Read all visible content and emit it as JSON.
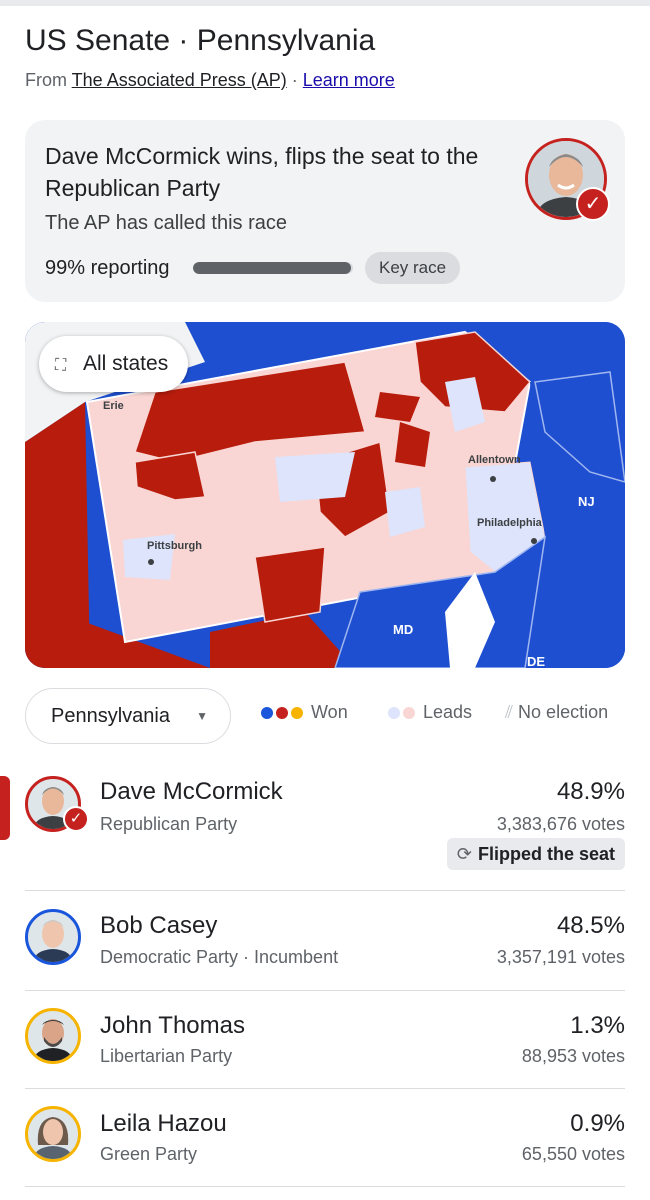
{
  "header": {
    "title": "US Senate · Pennsylvania",
    "source_prefix": "From ",
    "source_name": "The Associated Press (AP)",
    "separator": " · ",
    "learn_more": "Learn more"
  },
  "summary": {
    "headline": "Dave McCormick wins, flips the seat to the Republican Party",
    "called_text": "The AP has called this race",
    "reporting_text": "99% reporting",
    "reporting_fraction": 0.99,
    "key_race_label": "Key race"
  },
  "map": {
    "all_states_label": "All states",
    "labels": {
      "erie": "Erie",
      "allentown": "Allentown",
      "nj": "NJ",
      "philadelphia": "Philadelphia",
      "pittsburgh": "Pittsburgh",
      "md": "MD",
      "de": "DE"
    }
  },
  "filter": {
    "state_selected": "Pennsylvania"
  },
  "legend": {
    "won": "Won",
    "leads": "Leads",
    "no_election": "No election"
  },
  "candidates": [
    {
      "name": "Dave McCormick",
      "party": "Republican Party",
      "percent": "48.9%",
      "votes": "3,383,676 votes",
      "badge": "Flipped the seat",
      "color": "#c5221f"
    },
    {
      "name": "Bob Casey",
      "party": "Democratic Party · Incumbent",
      "percent": "48.5%",
      "votes": "3,357,191 votes",
      "color": "#1a56db"
    },
    {
      "name": "John Thomas",
      "party": "Libertarian Party",
      "percent": "1.3%",
      "votes": "88,953 votes",
      "color": "#f6b400"
    },
    {
      "name": "Leila Hazou",
      "party": "Green Party",
      "percent": "0.9%",
      "votes": "65,550 votes",
      "color": "#f6b400"
    }
  ],
  "colors": {
    "republican": "#c5221f",
    "democrat": "#1a56db",
    "lean_republican": "#f9d6d3",
    "lean_democrat": "#dde4fb",
    "other": "#f6b400"
  }
}
